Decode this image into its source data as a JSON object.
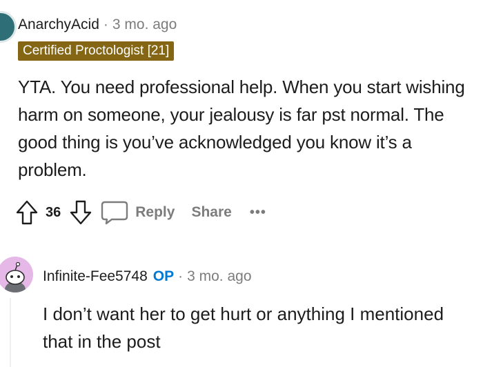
{
  "comment1": {
    "author": "AnarchyAcid",
    "separator": "·",
    "time": "3 mo. ago",
    "flair": "Certified Proctologist [21]",
    "body": "YTA. You need professional help. When you start wishing harm on someone, your jealousy is far pst normal. The good thing is you’ve acknowledged you know it’s a problem.",
    "score": "36",
    "reply_label": "Reply",
    "share_label": "Share",
    "more_label": "•••"
  },
  "comment2": {
    "author": "Infinite-Fee5748",
    "op_badge": "OP",
    "separator": "·",
    "time": "3 mo. ago",
    "body": "I don’t want her to get hurt or anything I mentioned that in the post"
  },
  "colors": {
    "flair_bg": "#846614",
    "op_blue": "#0079d3",
    "muted": "#7c7c7c",
    "avatar1_bg": "#2e6f77",
    "avatar2_bg": "#e6b8e8"
  },
  "icons": [
    "upvote-icon",
    "downvote-icon",
    "comment-bubble-icon",
    "more-options-icon",
    "snoo-avatar-icon"
  ]
}
